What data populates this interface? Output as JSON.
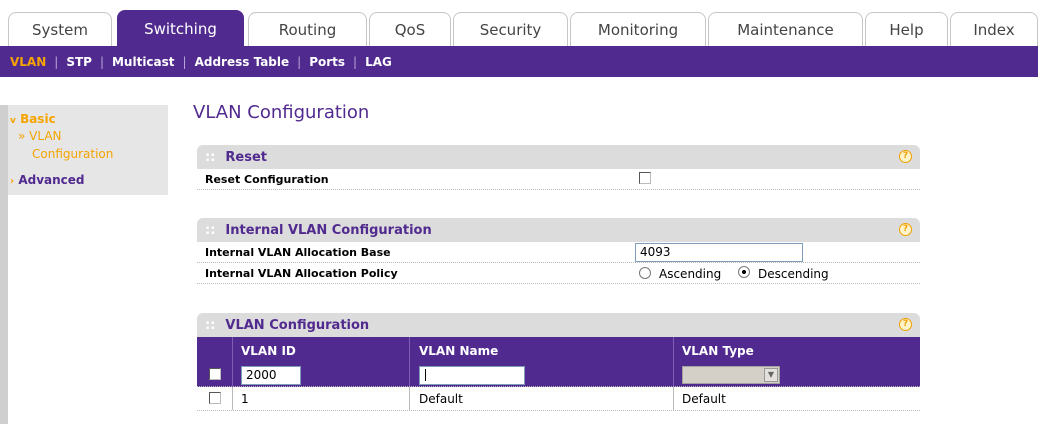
{
  "tabs": [
    {
      "label": "System",
      "active": false
    },
    {
      "label": "Switching",
      "active": true
    },
    {
      "label": "Routing",
      "active": false
    },
    {
      "label": "QoS",
      "active": false
    },
    {
      "label": "Security",
      "active": false
    },
    {
      "label": "Monitoring",
      "active": false
    },
    {
      "label": "Maintenance",
      "active": false
    },
    {
      "label": "Help",
      "active": false
    },
    {
      "label": "Index",
      "active": false
    }
  ],
  "subnav": [
    {
      "label": "VLAN",
      "active": true
    },
    {
      "label": "STP",
      "active": false
    },
    {
      "label": "Multicast",
      "active": false
    },
    {
      "label": "Address Table",
      "active": false
    },
    {
      "label": "Ports",
      "active": false
    },
    {
      "label": "LAG",
      "active": false
    }
  ],
  "leftnav": {
    "basic": "Basic",
    "vlan_line1": "» VLAN",
    "vlan_line2": "Configuration",
    "advanced": "Advanced"
  },
  "page": {
    "title": "VLAN Configuration"
  },
  "reset_panel": {
    "title": "Reset",
    "reset_label": "Reset Configuration",
    "reset_checked": false
  },
  "internal_panel": {
    "title": "Internal VLAN Configuration",
    "base_label": "Internal VLAN Allocation Base",
    "base_value": "4093",
    "policy_label": "Internal VLAN Allocation Policy",
    "ascending_label": "Ascending",
    "descending_label": "Descending",
    "policy_selected": "Descending"
  },
  "vlan_panel": {
    "title": "VLAN Configuration",
    "columns": [
      "VLAN ID",
      "VLAN Name",
      "VLAN Type"
    ],
    "new_row": {
      "vlan_id": "2000",
      "vlan_name": "",
      "vlan_type": ""
    },
    "rows": [
      {
        "vlan_id": "1",
        "vlan_name": "Default",
        "vlan_type": "Default"
      }
    ]
  },
  "colors": {
    "brand_purple": "#512a8f",
    "accent_orange": "#f5a400"
  }
}
